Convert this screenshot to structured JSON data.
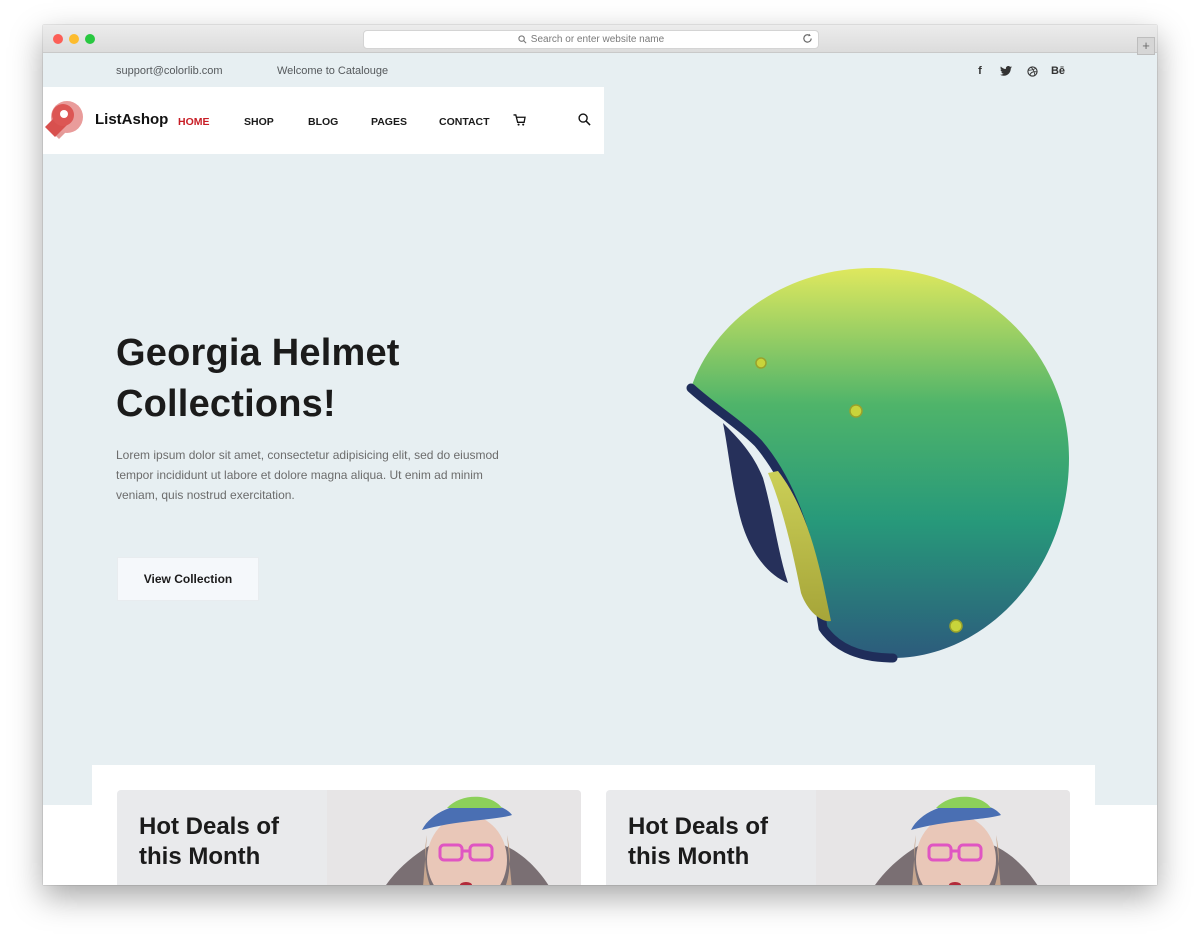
{
  "browser": {
    "address_placeholder": "Search or enter website name",
    "new_tab": "+"
  },
  "topbar": {
    "email": "support@colorlib.com",
    "welcome": "Welcome to Catalouge",
    "social": [
      "facebook-icon",
      "twitter-icon",
      "dribbble-icon",
      "behance-icon"
    ],
    "behance_label": "Bē",
    "facebook_label": "f"
  },
  "nav": {
    "brand": "ListAshop",
    "items": [
      {
        "label": "HOME",
        "active": true
      },
      {
        "label": "SHOP",
        "active": false
      },
      {
        "label": "BLOG",
        "active": false
      },
      {
        "label": "PAGES",
        "active": false
      },
      {
        "label": "CONTACT",
        "active": false
      }
    ]
  },
  "hero": {
    "title_line1": "Georgia Helmet",
    "title_line2": "Collections!",
    "body": "Lorem ipsum dolor sit amet, consectetur adipisicing elit, sed do eiusmod tempor incididunt ut labore et dolore magna aliqua. Ut enim ad minim veniam, quis nostrud exercitation.",
    "button": "View Collection"
  },
  "deals": [
    {
      "line1": "Hot Deals of",
      "line2": "this Month"
    },
    {
      "line1": "Hot Deals of",
      "line2": "this Month"
    }
  ],
  "colors": {
    "accent": "#c81d25",
    "background": "#e7eff2",
    "logo": "#e0605e"
  }
}
